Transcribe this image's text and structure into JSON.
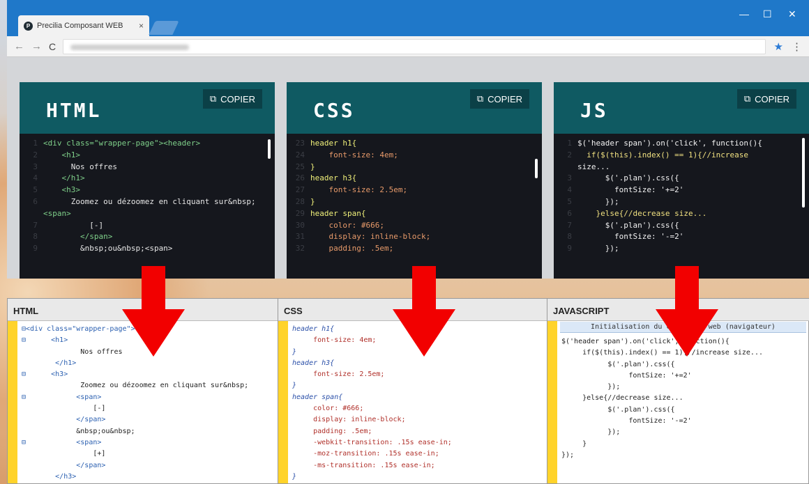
{
  "browser": {
    "tab_title": "Precilia Composant WEB",
    "tab_close": "×",
    "favicon_letter": "P",
    "nav_back": "←",
    "nav_fwd": "→",
    "reload": "C",
    "star": "★",
    "menu": "⋮",
    "minimize": "—",
    "maximize": "☐",
    "close": "✕"
  },
  "cards": [
    {
      "title": "HTML",
      "copy_label": "COPIER",
      "copy_icon": "⧉",
      "lines": [
        {
          "n": "1",
          "t": "<div class=\"wrapper-page\"><header>"
        },
        {
          "n": "2",
          "t": "    <h1>"
        },
        {
          "n": "3",
          "t": "      Nos offres"
        },
        {
          "n": "4",
          "t": "    </h1>"
        },
        {
          "n": "5",
          "t": "    <h3>"
        },
        {
          "n": "6",
          "t": "      Zoomez ou dézoomez en cliquant sur&nbsp;"
        },
        {
          "n": "",
          "t": "<span>"
        },
        {
          "n": "7",
          "t": "          [-]"
        },
        {
          "n": "8",
          "t": "        </span>"
        },
        {
          "n": "9",
          "t": "        &nbsp;ou&nbsp;<span>"
        }
      ]
    },
    {
      "title": "CSS",
      "copy_label": "COPIER",
      "copy_icon": "⧉",
      "lines": [
        {
          "n": "23",
          "t": "header h1{"
        },
        {
          "n": "24",
          "t": "    font-size: 4em;"
        },
        {
          "n": "25",
          "t": "}"
        },
        {
          "n": "26",
          "t": "header h3{"
        },
        {
          "n": "27",
          "t": "    font-size: 2.5em;"
        },
        {
          "n": "28",
          "t": "}"
        },
        {
          "n": "29",
          "t": "header span{"
        },
        {
          "n": "30",
          "t": "    color: #666;"
        },
        {
          "n": "31",
          "t": "    display: inline-block;"
        },
        {
          "n": "32",
          "t": "    padding: .5em;"
        }
      ]
    },
    {
      "title": "JS",
      "copy_label": "COPIER",
      "copy_icon": "⧉",
      "lines": [
        {
          "n": "1",
          "t": "$('header span').on('click', function(){"
        },
        {
          "n": "2",
          "t": "  if($(this).index() == 1){//increase"
        },
        {
          "n": "",
          "t": "size..."
        },
        {
          "n": "3",
          "t": "      $('.plan').css({"
        },
        {
          "n": "4",
          "t": "        fontSize: '+=2'"
        },
        {
          "n": "5",
          "t": "      });"
        },
        {
          "n": "6",
          "t": "    }else{//decrease size..."
        },
        {
          "n": "7",
          "t": "      $('.plan').css({"
        },
        {
          "n": "8",
          "t": "        fontSize: '-=2'"
        },
        {
          "n": "9",
          "t": "      });"
        }
      ]
    }
  ],
  "editors": [
    {
      "title": "HTML",
      "lines": [
        "⊟<div class=\"wrapper-page\"><header>",
        "⊟      <h1>",
        "              Nos offres",
        "        </h1>",
        "⊟      <h3>",
        "              Zoomez ou dézoomez en cliquant sur&nbsp;",
        "⊟            <span>",
        "                 [-]",
        "             </span>",
        "             &nbsp;ou&nbsp;",
        "⊟            <span>",
        "                 [+]",
        "             </span>",
        "        </h3>"
      ]
    },
    {
      "title": "CSS",
      "lines": [
        "header h1{",
        "     font-size: 4em;",
        "}",
        "header h3{",
        "     font-size: 2.5em;",
        "}",
        "header span{",
        "     color: #666;",
        "     display: inline-block;",
        "     padding: .5em;",
        "     -webkit-transition: .15s ease-in;",
        "     -moz-transition: .15s ease-in;",
        "     -ms-transition: .15s ease-in;",
        "}"
      ]
    },
    {
      "title": "JAVASCRIPT",
      "header_line": "Initialisation du composant web  (navigateur)",
      "lines": [
        "$('header span').on('click', function(){",
        "     if($(this).index() == 1){//increase size...",
        "           $('.plan').css({",
        "                fontSize: '+=2'",
        "           });",
        "     }else{//decrease size...",
        "           $('.plan').css({",
        "                fontSize: '-=2'",
        "           });",
        "     }",
        "});"
      ]
    }
  ],
  "colors": {
    "arrow": "#f20000",
    "card_header": "#0f5a62",
    "code_bg": "#15171d",
    "gutter": "#ffd32a",
    "titlebar": "#1f78c9"
  }
}
